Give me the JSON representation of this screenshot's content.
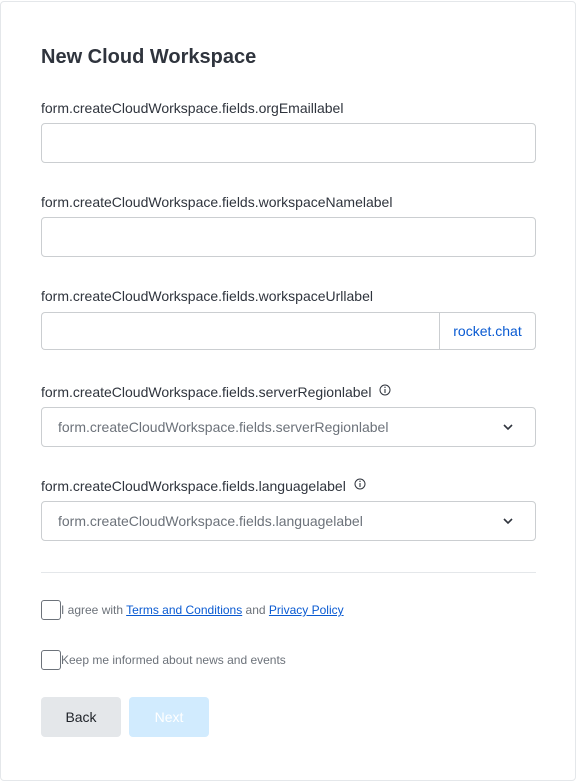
{
  "form": {
    "title": "New Cloud Workspace",
    "org_email_label": "form.createCloudWorkspace.fields.orgEmaillabel",
    "workspace_name_label": "form.createCloudWorkspace.fields.workspaceNamelabel",
    "workspace_url_label": "form.createCloudWorkspace.fields.workspaceUrllabel",
    "workspace_url_suffix": "rocket.chat",
    "server_region_label": "form.createCloudWorkspace.fields.serverRegionlabel",
    "server_region_placeholder": "form.createCloudWorkspace.fields.serverRegionlabel",
    "language_label": "form.createCloudWorkspace.fields.languagelabel",
    "language_placeholder": "form.createCloudWorkspace.fields.languagelabel"
  },
  "terms": {
    "prefix": "I agree with ",
    "terms_link": "Terms and Conditions",
    "and": " and ",
    "privacy_link": "Privacy Policy"
  },
  "updates": {
    "label": "Keep me informed about news and events"
  },
  "actions": {
    "back_label": "Back",
    "next_label": "Next"
  },
  "colors": {
    "link": "#095ad2",
    "next_disabled_bg": "#d1ebfe",
    "back_bg": "#e4e7ea"
  }
}
